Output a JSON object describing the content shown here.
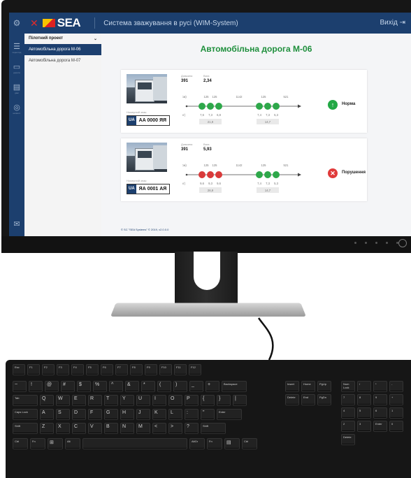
{
  "app": {
    "title": "Система зважування в русі (WIM-System)",
    "logo_text": "SEA",
    "exit_label": "Вихід"
  },
  "iconbar": {
    "items": [
      {
        "icon": "sliders-icon",
        "label": "перегляд"
      },
      {
        "icon": "monitor-icon",
        "label": "дорога"
      },
      {
        "icon": "server-icon",
        "label": "дані"
      },
      {
        "icon": "settings-icon",
        "label": "налашт."
      }
    ]
  },
  "nav": {
    "project": "Пілотний проект",
    "items": [
      {
        "label": "Автомобільна дорога М-06",
        "active": true
      },
      {
        "label": "Автомобільна дорога М-07",
        "active": false
      }
    ]
  },
  "main": {
    "title": "Автомобільна дорога М-06",
    "footer": "© SC \"SEA Systems\" © 2019, v2.0.0.0"
  },
  "cards": [
    {
      "length_label": "Довжина",
      "length": "391",
      "weight_label": "Вага",
      "weight": "2,34",
      "plate_label": "Номерний знак:",
      "plate_country": "UA",
      "plate_number": "AA 0000 ЯЯ",
      "dist_label": "(см)",
      "load_label": "(кг)",
      "distances": [
        "125",
        "125",
        "1142",
        "125",
        "521"
      ],
      "loads": [
        "7,6",
        "7,3",
        "6,8",
        "7,4",
        "7,3",
        "5,3"
      ],
      "group_totals": [
        "21,9",
        "14,7"
      ],
      "axle_colors": [
        "#2ea84a",
        "#2ea84a",
        "#2ea84a",
        "#2ea84a",
        "#2ea84a",
        "#2ea84a"
      ],
      "status": "Норма",
      "status_color": "#22a845"
    },
    {
      "length_label": "Довжина",
      "length": "391",
      "weight_label": "Вага",
      "weight": "5,93",
      "plate_label": "Номерний знак:",
      "plate_country": "UA",
      "plate_number": "ЯА 0001 АЯ",
      "dist_label": "(см)",
      "load_label": "(кг)",
      "distances": [
        "125",
        "125",
        "1142",
        "125",
        "521"
      ],
      "loads": [
        "9,6",
        "9,3",
        "9,6",
        "7,4",
        "7,3",
        "5,3"
      ],
      "group_totals": [
        "26,9",
        "14,7"
      ],
      "axle_colors": [
        "#d93a3a",
        "#d93a3a",
        "#d93a3a",
        "#2ea84a",
        "#2ea84a",
        "#2ea84a"
      ],
      "status": "Порушення",
      "status_color": "#e03a3a"
    }
  ],
  "keyboard": {
    "rows": [
      [
        "Esc",
        "F1",
        "F2",
        "F3",
        "F4",
        "F5",
        "F6",
        "F7",
        "F8",
        "F9",
        "F10",
        "F11",
        "F12"
      ],
      [
        "~",
        "!",
        "@",
        "#",
        "$",
        "%",
        "^",
        "&",
        "*",
        "(",
        ")",
        "_",
        "+",
        "Backspace"
      ],
      [
        "Tab",
        "Q",
        "W",
        "E",
        "R",
        "T",
        "Y",
        "U",
        "I",
        "O",
        "P",
        "{",
        "}",
        "|"
      ],
      [
        "Caps Lock",
        "A",
        "S",
        "D",
        "F",
        "G",
        "H",
        "J",
        "K",
        "L",
        ":",
        "\"",
        "Enter"
      ],
      [
        "Shift",
        "Z",
        "X",
        "C",
        "V",
        "B",
        "N",
        "M",
        "<",
        ">",
        "?",
        "Shift"
      ],
      [
        "Ctrl",
        "Fn",
        "⊞",
        "Alt",
        "",
        "AltGr",
        "Fn",
        "▤",
        "Ctrl"
      ]
    ],
    "nav_keys": [
      "Insert",
      "Home",
      "PgUp",
      "Delete",
      "End",
      "PgDn"
    ],
    "numpad": [
      "Num Lock",
      "/",
      "*",
      "-",
      "7",
      "8",
      "9",
      "+",
      "4",
      "5",
      "6",
      "1",
      "2",
      "3",
      "Enter",
      "0",
      "Delete"
    ]
  }
}
